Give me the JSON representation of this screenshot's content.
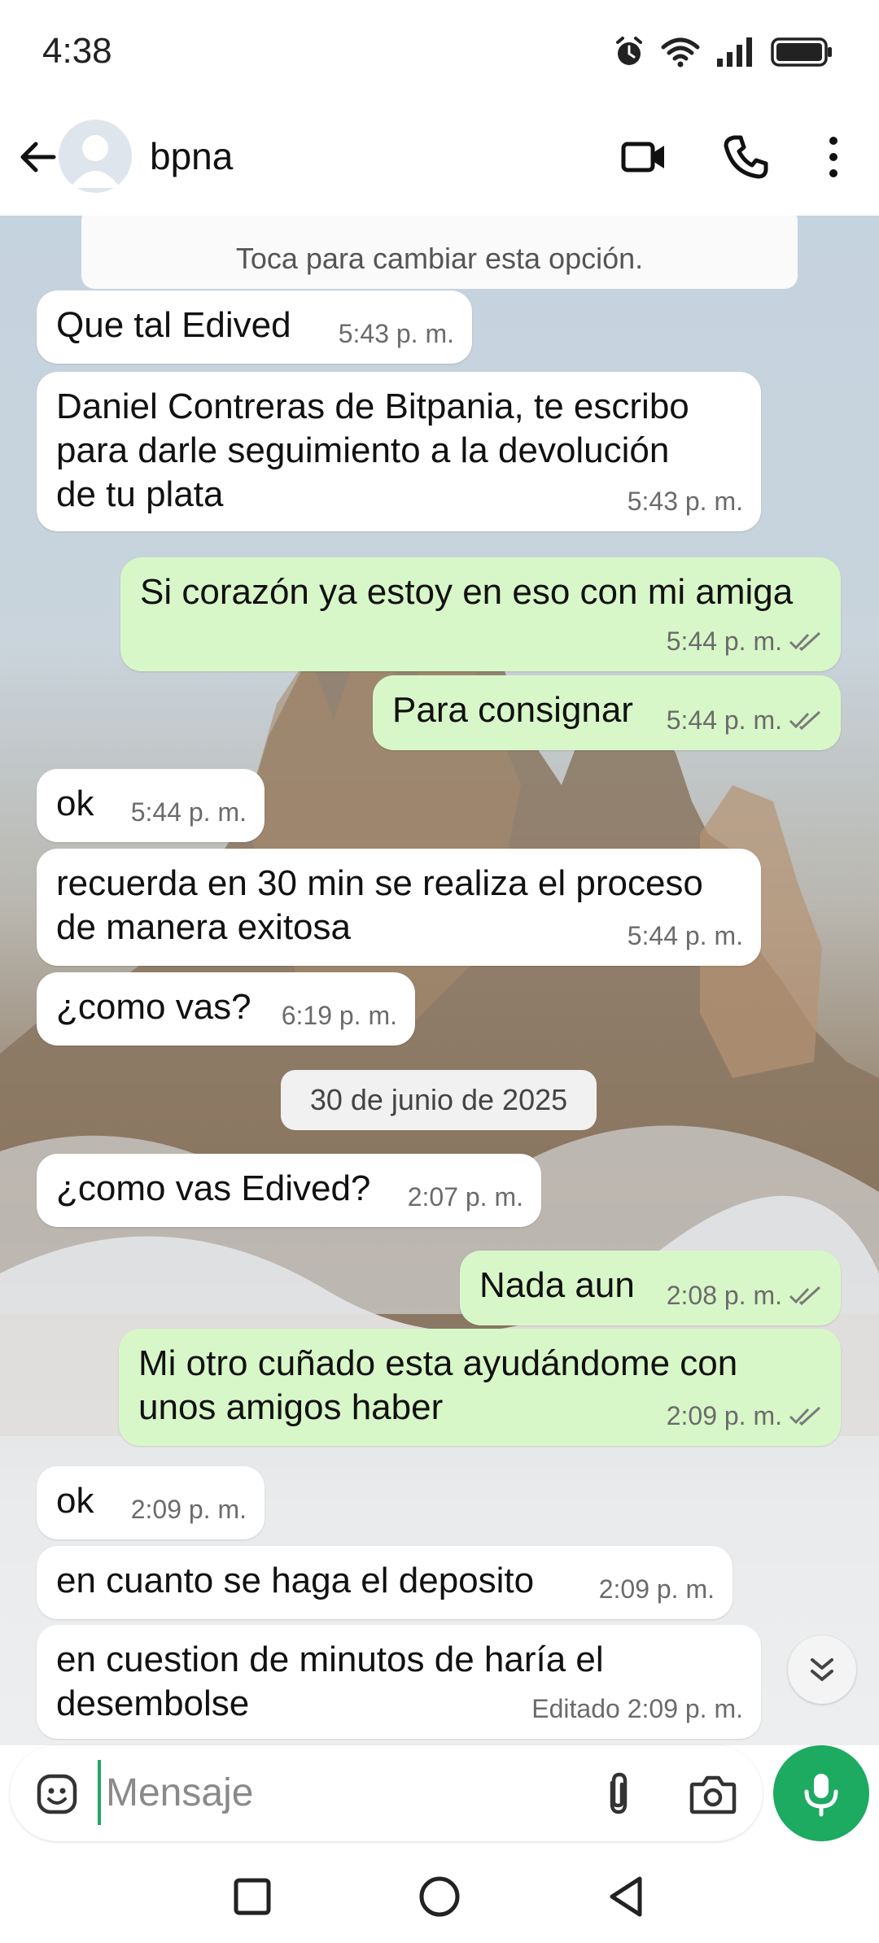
{
  "status_bar": {
    "time": "4:38",
    "icons": [
      "alarm-icon",
      "wifi-icon",
      "signal-icon",
      "battery-icon"
    ]
  },
  "app_bar": {
    "contact_name": "bpna",
    "icons": [
      "back-arrow-icon",
      "avatar",
      "video-call-icon",
      "phone-icon",
      "more-vert-icon"
    ]
  },
  "chat": {
    "system_note": "Toca para cambiar esta opción.",
    "date_separator": "30 de junio de 2025",
    "messages": [
      {
        "dir": "in",
        "text": "Que tal Edived",
        "time": "5:43 p. m."
      },
      {
        "dir": "in",
        "text": "Daniel Contreras de Bitpania, te escribo\npara darle seguimiento a la devolución\nde tu plata",
        "time": "5:43 p. m."
      },
      {
        "dir": "out",
        "text": "Si corazón ya estoy en eso con mi amiga",
        "time": "5:44 p. m."
      },
      {
        "dir": "out",
        "text": "Para consignar",
        "time": "5:44 p. m."
      },
      {
        "dir": "in",
        "text": "ok",
        "time": "5:44 p. m."
      },
      {
        "dir": "in",
        "text": "recuerda en 30 min se realiza el proceso\nde manera exitosa",
        "time": "5:44 p. m."
      },
      {
        "dir": "in",
        "text": "¿como vas?",
        "time": "6:19 p. m."
      },
      {
        "dir": "in",
        "text": "¿como vas Edived?",
        "time": "2:07 p. m."
      },
      {
        "dir": "out",
        "text": "Nada aun",
        "time": "2:08 p. m."
      },
      {
        "dir": "out",
        "text": "Mi otro cuñado esta ayudándome con\nunos amigos haber",
        "time": "2:09 p. m."
      },
      {
        "dir": "in",
        "text": "ok",
        "time": "2:09 p. m."
      },
      {
        "dir": "in",
        "text": "en cuanto se haga el deposito",
        "time": "2:09 p. m."
      },
      {
        "dir": "in",
        "text": "en cuestion de minutos de haría el\ndesembolse",
        "time": "Editado 2:09 p. m."
      }
    ]
  },
  "input_bar": {
    "placeholder": "Mensaje",
    "icons": [
      "emoji-icon",
      "attach-icon",
      "camera-icon",
      "mic-icon"
    ]
  },
  "nav_bar": {
    "icons": [
      "recents-icon",
      "home-icon",
      "back-icon"
    ]
  },
  "colors": {
    "accent": "#1daa61",
    "outgoing_bubble": "#d8f7c8",
    "incoming_bubble": "#ffffff",
    "read_ticks": "#7a7a7a"
  }
}
